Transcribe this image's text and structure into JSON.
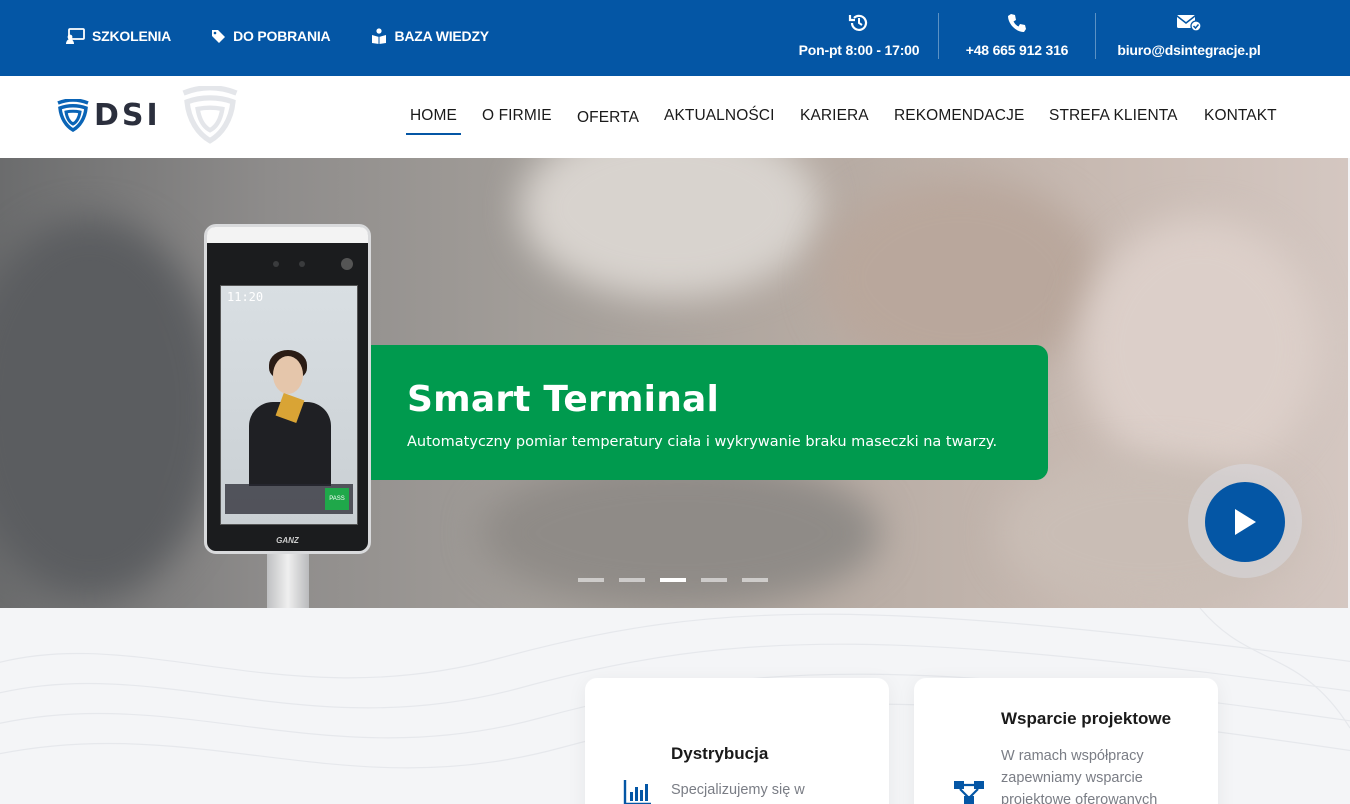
{
  "topbar": {
    "links": [
      {
        "label": "SZKOLENIA",
        "icon": "training-icon"
      },
      {
        "label": "DO POBRANIA",
        "icon": "tags-icon"
      },
      {
        "label": "BAZA WIEDZY",
        "icon": "book-reader-icon"
      }
    ],
    "contacts": [
      {
        "label": "Pon-pt 8:00 - 17:00",
        "icon": "history-clock-icon"
      },
      {
        "label": "+48 665 912 316",
        "icon": "phone-icon"
      },
      {
        "label": "biuro@dsintegracje.pl",
        "icon": "mail-check-icon"
      }
    ]
  },
  "nav": {
    "logo_text": "DSI",
    "items": [
      "HOME",
      "O FIRMIE",
      "OFERTA",
      "AKTUALNOŚCI",
      "KARIERA",
      "REKOMENDACJE",
      "STREFA KLIENTA",
      "KONTAKT"
    ],
    "active": "HOME"
  },
  "hero": {
    "title": "Smart Terminal",
    "subtitle": "Automatyczny pomiar temperatury ciała i wykrywanie braku maseczki na twarzy.",
    "device_time": "11:20",
    "device_brand": "GANZ",
    "pass_label": "PASS",
    "slide_count": 5,
    "active_slide": 3,
    "colors": {
      "card": "#009a4e",
      "accent": "#0456a5"
    }
  },
  "cards": [
    {
      "title": "Dystrybucja",
      "text": "Specjalizujemy się w",
      "icon": "bar-chart-icon"
    },
    {
      "title": "Wsparcie projektowe",
      "text": "W ramach współpracy zapewniamy wsparcie projektowe oferowanych",
      "icon": "network-icon"
    }
  ]
}
